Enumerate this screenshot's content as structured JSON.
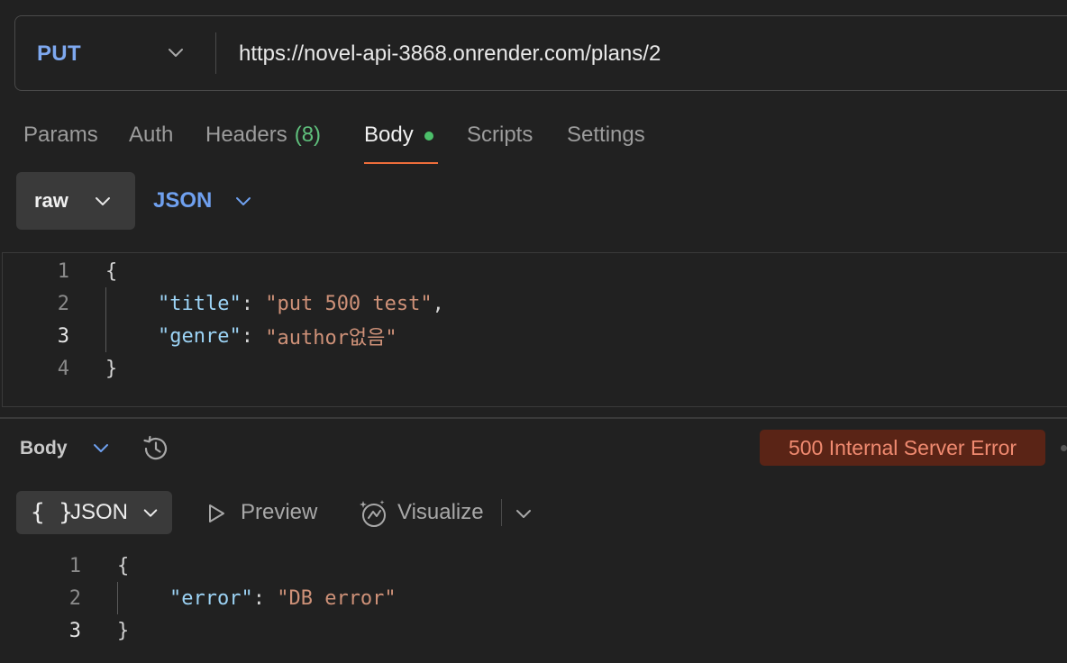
{
  "request": {
    "method": "PUT",
    "url": "https://novel-api-3868.onrender.com/plans/2"
  },
  "tabs": [
    {
      "label": "Params"
    },
    {
      "label": "Auth"
    },
    {
      "label": "Headers",
      "count": "(8)"
    },
    {
      "label": "Body",
      "active": true
    },
    {
      "label": "Scripts"
    },
    {
      "label": "Settings"
    }
  ],
  "body_mode": {
    "mode": "raw",
    "type": "JSON"
  },
  "request_body": {
    "line_numbers": [
      "1",
      "2",
      "3",
      "4"
    ],
    "lines": {
      "l1": "{",
      "l2_key": "\"title\"",
      "l2_sep": ": ",
      "l2_val": "\"put 500 test\"",
      "l2_end": ",",
      "l3_key": "\"genre\"",
      "l3_sep": ": ",
      "l3_val": "\"author없음\"",
      "l4": "}"
    }
  },
  "response": {
    "body_label": "Body",
    "status": "500 Internal Server Error",
    "views": {
      "json_icon": "{ }",
      "json_label": "JSON",
      "preview_label": "Preview",
      "visualize_label": "Visualize"
    },
    "body": {
      "line_numbers": [
        "1",
        "2",
        "3"
      ],
      "lines": {
        "l1": "{",
        "l2_key": "\"error\"",
        "l2_sep": ": ",
        "l2_val": "\"DB error\"",
        "l3": "}"
      }
    }
  },
  "colors": {
    "background": "#212121",
    "method": "#7ea8ef",
    "active_tab_underline": "#ed6d3b",
    "body_dot": "#4cbf6a",
    "error_badge_bg": "#5a2416",
    "error_badge_text": "#f08a70"
  },
  "icons": [
    "chevron-down-icon",
    "history-icon",
    "play-icon",
    "visualize-icon"
  ]
}
